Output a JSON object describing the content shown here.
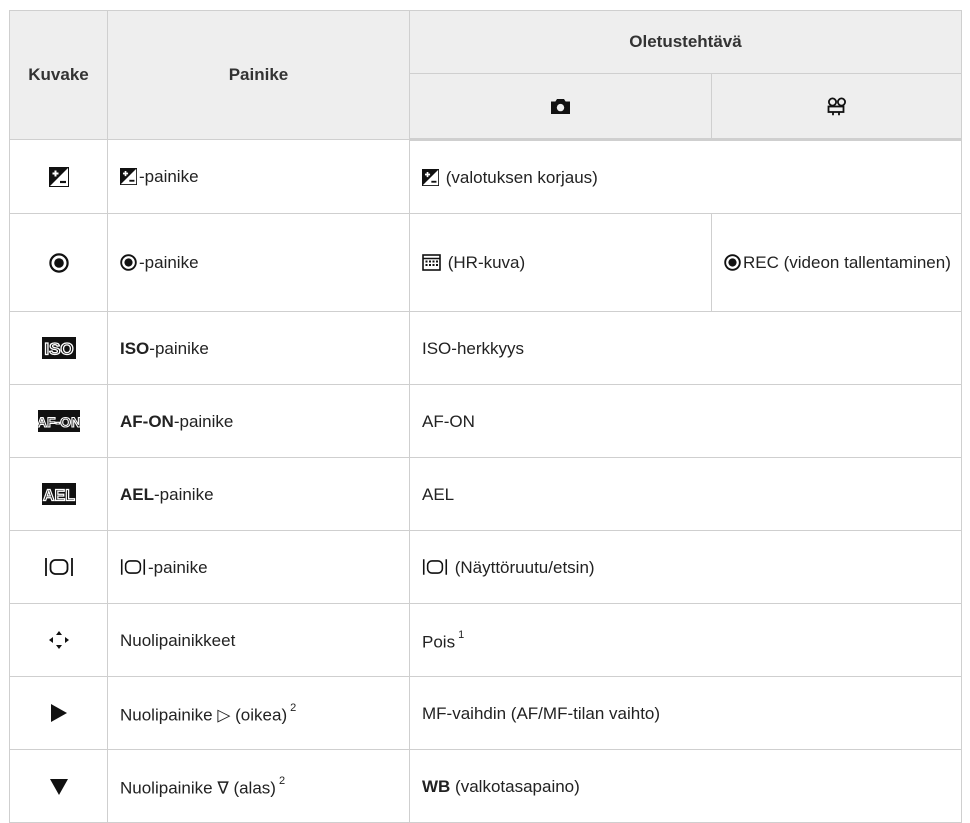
{
  "header": {
    "col_icon": "Kuvake",
    "col_button": "Painike",
    "col_default": "Oletustehtävä",
    "photo_icon": "camera-icon",
    "movie_icon": "movie-camera-icon"
  },
  "rows": [
    {
      "icon": "exposure-compensation-icon",
      "button": {
        "suffix": "-painike"
      },
      "function": {
        "text": " (valotuksen korjaus)"
      }
    },
    {
      "icon": "record-icon",
      "button": {
        "suffix": "-painike"
      },
      "function_photo": {
        "text": " (HR-kuva)"
      },
      "function_movie": {
        "text": "REC (videon tallentaminen)"
      }
    },
    {
      "icon": "iso-icon",
      "icon_text": "ISO",
      "button": {
        "bold": "ISO",
        "suffix": "-painike"
      },
      "function": {
        "text": "ISO-herkkyys"
      }
    },
    {
      "icon": "af-on-icon",
      "icon_text": "AF-ON",
      "button": {
        "bold": "AF-ON",
        "suffix": "-painike"
      },
      "function": {
        "text": "AF-ON"
      }
    },
    {
      "icon": "ael-icon",
      "icon_text": "AEL",
      "button": {
        "bold": "AEL",
        "suffix": "-painike"
      },
      "function": {
        "text": "AEL"
      }
    },
    {
      "icon": "lv-switch-icon",
      "button": {
        "suffix": "-painike"
      },
      "function": {
        "text": " (Näyttöruutu/etsin)"
      }
    },
    {
      "icon": "arrow-pad-icon",
      "button": {
        "text": "Nuolipainikkeet"
      },
      "function": {
        "text": "Pois",
        "sup": "1"
      }
    },
    {
      "icon": "right-triangle-icon",
      "button": {
        "text": "Nuolipainike ",
        "arrow": "▷",
        "after": " (oikea)",
        "sup": "2"
      },
      "function": {
        "text": "MF-vaihdin (AF/MF-tilan vaihto)"
      }
    },
    {
      "icon": "down-triangle-icon",
      "button": {
        "text": "Nuolipainike ",
        "arrow": "∇",
        "after": " (alas)",
        "sup": "2"
      },
      "function": {
        "bold": "WB",
        "text": " (valkotasapaino)"
      }
    }
  ]
}
